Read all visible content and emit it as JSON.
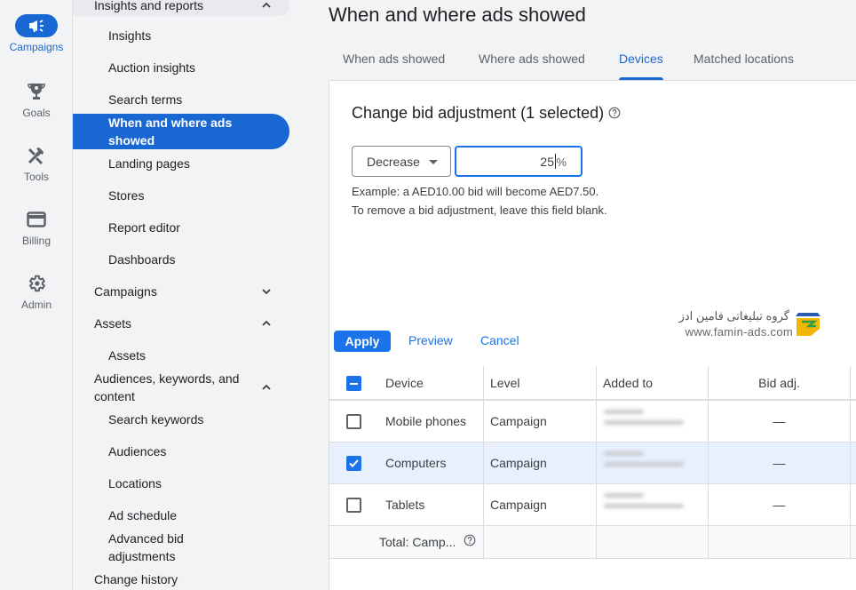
{
  "rail": {
    "items": [
      {
        "label": "Campaigns",
        "icon": "megaphone-icon",
        "active": true
      },
      {
        "label": "Goals",
        "icon": "trophy-icon"
      },
      {
        "label": "Tools",
        "icon": "tools-icon"
      },
      {
        "label": "Billing",
        "icon": "credit-card-icon"
      },
      {
        "label": "Admin",
        "icon": "gear-icon"
      }
    ]
  },
  "nav": {
    "insights_group": "Insights and reports",
    "insights_items": [
      "Insights",
      "Auction insights",
      "Search terms",
      "When and where ads showed",
      "Landing pages",
      "Stores",
      "Report editor",
      "Dashboards"
    ],
    "campaigns_group": "Campaigns",
    "assets_group": "Assets",
    "assets_items": [
      "Assets"
    ],
    "audiences_group": "Audiences, keywords, and content",
    "audiences_items": [
      "Search keywords",
      "Audiences",
      "Locations",
      "Ad schedule",
      "Advanced bid adjustments"
    ],
    "change_history": "Change history"
  },
  "page": {
    "title": "When and where ads showed",
    "tabs": [
      {
        "label": "When ads showed"
      },
      {
        "label": "Where ads showed"
      },
      {
        "label": "Devices",
        "active": true
      },
      {
        "label": "Matched locations"
      }
    ]
  },
  "bid_panel": {
    "title": "Change bid adjustment (1 selected)",
    "direction_selected": "Decrease",
    "percent_value": "25",
    "percent_suffix": "%",
    "example_text": "Example: a AED10.00 bid will become AED7.50.",
    "remove_hint": "To remove a bid adjustment, leave this field blank.",
    "apply_label": "Apply",
    "preview_label": "Preview",
    "cancel_label": "Cancel"
  },
  "watermark": {
    "text_fa": "گروه تبلیغاتی فامین ادز",
    "url": "www.famin-ads.com"
  },
  "table": {
    "columns": [
      "Device",
      "Level",
      "Added to",
      "Bid adj."
    ],
    "rows": [
      {
        "device": "Mobile phones",
        "level": "Campaign",
        "added_to": "[blurred]",
        "bid_adj": "—",
        "checked": false
      },
      {
        "device": "Computers",
        "level": "Campaign",
        "added_to": "[blurred]",
        "bid_adj": "—",
        "checked": true
      },
      {
        "device": "Tablets",
        "level": "Campaign",
        "added_to": "[blurred]",
        "bid_adj": "—",
        "checked": false
      }
    ],
    "total_label": "Total: Camp..."
  },
  "colors": {
    "accent": "#1a73e8",
    "nav_active": "#1967d2",
    "selected_row": "#e8f0fe"
  }
}
